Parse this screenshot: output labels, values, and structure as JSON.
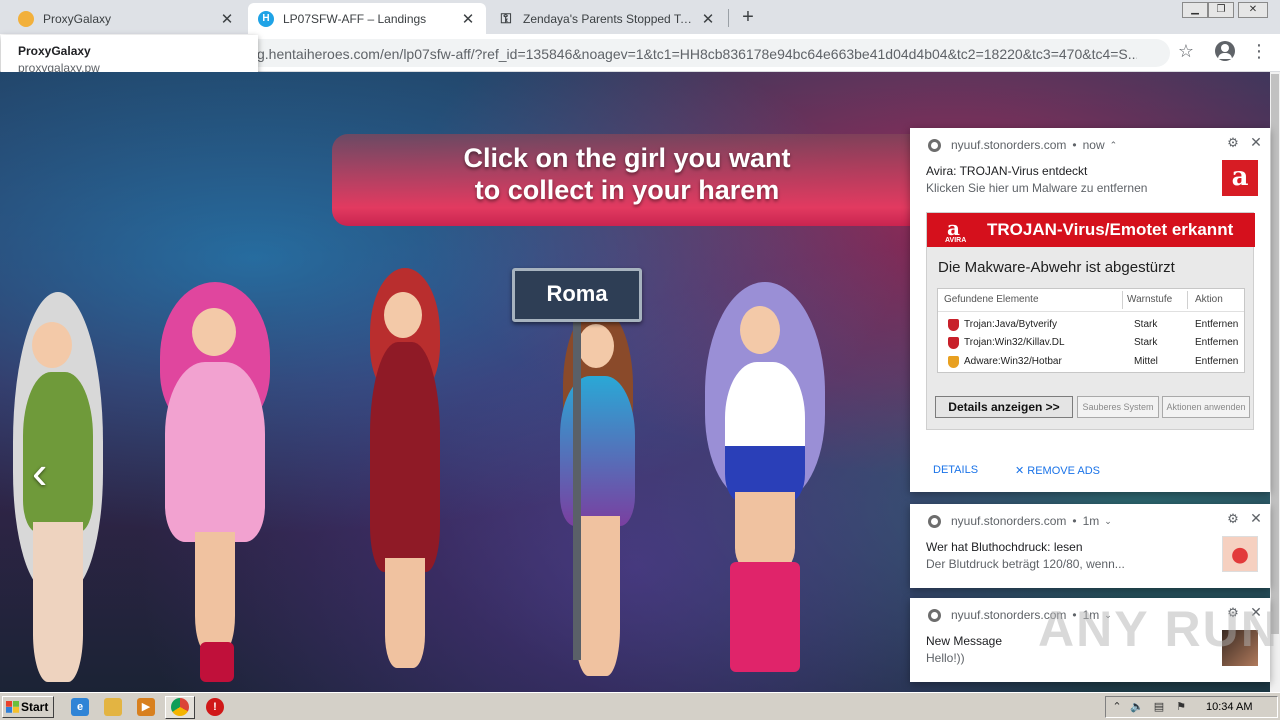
{
  "browser": {
    "tabs": [
      {
        "title": "ProxyGalaxy",
        "close": "✕",
        "favicon_color": "#f2b03c"
      },
      {
        "title": "LP07SFW-AFF – Landings",
        "close": "✕",
        "favicon_color": "#1fa3e6",
        "favicon_glyph": "H"
      },
      {
        "title": "Zendaya's Parents Stopped Telling H",
        "close": "✕"
      }
    ],
    "new_tab": "+",
    "window_controls": {
      "minimize": "▁",
      "maximize": "❐",
      "close": "✕"
    },
    "url": "g.hentaiheroes.com/en/lp07sfw-aff/?ref_id=135846&noagev=1&tc1=HH8cb836178e94bc64e663be41d04d4b04&tc2=18220&tc3=470&tc4=S...",
    "star": "☆",
    "kebab": "⋮",
    "hovercard": {
      "title": "ProxyGalaxy",
      "domain": "proxygalaxy.pw"
    }
  },
  "page": {
    "banner_line1": "Click on the girl you want",
    "banner_line2": "to collect in your harem",
    "sign": "Roma",
    "arrow": "‹"
  },
  "notifications": [
    {
      "domain": "nyuuf.stonorders.com",
      "time": "now",
      "chevron": "⌃",
      "title": "Avira: TROJAN-Virus entdeckt",
      "body": "Klicken Sie hier um Malware zu entfernen",
      "logo": "a",
      "avira": {
        "brand": "AVIRA",
        "header": "TROJAN-Virus/Emotet erkannt",
        "subtitle": "Die Makware-Abwehr ist abgestürzt",
        "columns": [
          "Gefundene Elemente",
          "Warnstufe",
          "Aktion"
        ],
        "rows": [
          {
            "item": "Trojan:Java/Bytverify",
            "level": "Stark",
            "action": "Entfernen",
            "color": "#c8202a"
          },
          {
            "item": "Trojan:Win32/Killav.DL",
            "level": "Stark",
            "action": "Entfernen",
            "color": "#c8202a"
          },
          {
            "item": "Adware:Win32/Hotbar",
            "level": "Mittel",
            "action": "Entfernen",
            "color": "#e8a020"
          }
        ],
        "btn_details": "Details anzeigen >>",
        "btn_clean": "Sauberes System",
        "btn_apply": "Aktionen anwenden"
      },
      "action_details": "DETAILS",
      "action_remove": "✕ REMOVE ADS"
    },
    {
      "domain": "nyuuf.stonorders.com",
      "time": "1m",
      "chevron": "⌄",
      "title": "Wer hat Bluthochdruck: lesen",
      "body": "Der Blutdruck beträgt 120/80, wenn..."
    },
    {
      "domain": "nyuuf.stonorders.com",
      "time": "1m",
      "chevron": "⌄",
      "title": "New Message",
      "body": "Hello!))"
    }
  ],
  "taskbar": {
    "start": "Start",
    "clock": "10:34 AM",
    "tray_up": "⌃"
  },
  "watermark": "ANY RUN",
  "colors": {
    "avira_red": "#d5101c",
    "link_blue": "#1a73e8",
    "banner_pink": "#e23a60"
  }
}
